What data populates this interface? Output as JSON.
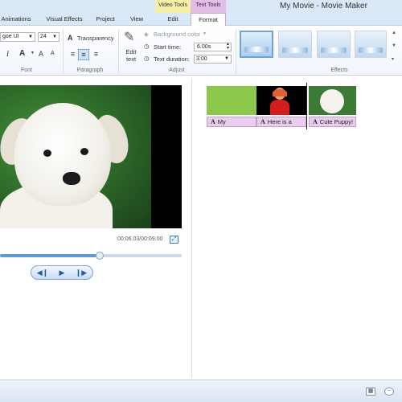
{
  "window": {
    "title": "My Movie - Movie Maker"
  },
  "tabs": [
    {
      "label": "Animations"
    },
    {
      "label": "Visual Effects"
    },
    {
      "label": "Project"
    },
    {
      "label": "View"
    },
    {
      "label": "Edit"
    },
    {
      "label": "Format"
    }
  ],
  "context_tabs": {
    "video_tools": "Video Tools",
    "text_tools": "Text Tools"
  },
  "ribbon": {
    "font": {
      "family": "goe UI",
      "size": "24",
      "italic": "I",
      "grow": "A",
      "shrink": "A",
      "color": "A",
      "group_label": "Font"
    },
    "paragraph": {
      "transparency_label": "Transparency",
      "group_label": "Paragraph"
    },
    "adjust": {
      "edit_text_label": "Edit\ntext",
      "background_color_label": "Background color",
      "start_time_label": "Start time:",
      "start_time_value": "6.00s",
      "text_duration_label": "Text duration:",
      "text_duration_value": "3.00",
      "group_label": "Adjust"
    },
    "effects": {
      "group_label": "Effects",
      "selected_index": 0
    }
  },
  "preview": {
    "timecode": "00:06.03/00:09.00",
    "playback_progress": 0.55
  },
  "storyboard": {
    "items": [
      {
        "caption": "My",
        "thumb": "green-title"
      },
      {
        "caption": "Here is a",
        "thumb": "person"
      },
      {
        "caption": "Cute Puppy!",
        "thumb": "puppy"
      }
    ]
  },
  "colors": {
    "ribbon_bg": "#f1f5fb",
    "video_tools": "#f5f0a6",
    "text_tools": "#e3bde8",
    "caption_bg": "#e8cdef",
    "accent": "#5b9bd8"
  }
}
